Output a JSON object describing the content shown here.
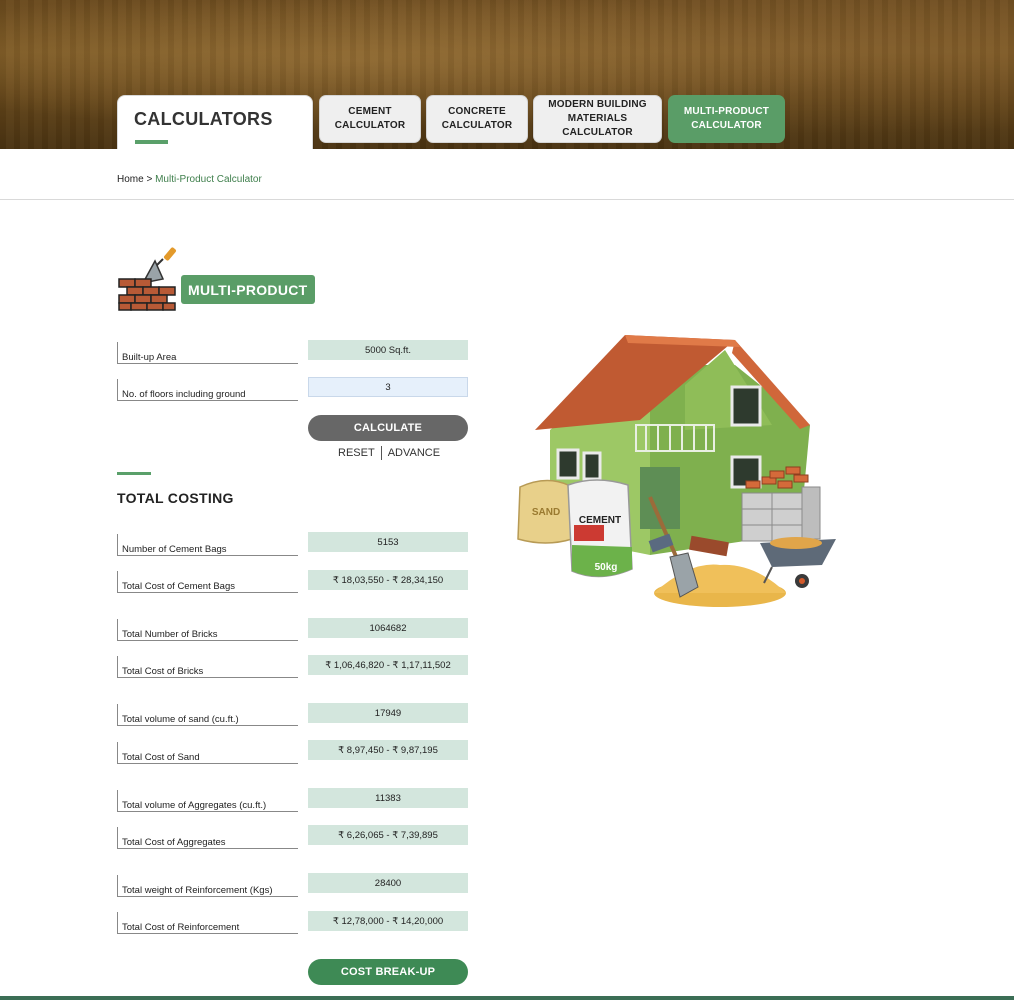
{
  "header": {
    "section_title": "CALCULATORS",
    "tabs": [
      {
        "label": "CEMENT\nCALCULATOR"
      },
      {
        "label": "CONCRETE\nCALCULATOR"
      },
      {
        "label": "MODERN BUILDING\nMATERIALS\nCALCULATOR"
      },
      {
        "label": "MULTI-PRODUCT\nCALCULATOR",
        "active": true
      }
    ]
  },
  "breadcrumb": {
    "home": "Home",
    "separator": ">",
    "current": "Multi-Product Calculator"
  },
  "product": {
    "badge_label": "MULTI-PRODUCT",
    "icon": "brick-trowel-icon"
  },
  "inputs": {
    "built_up_area": {
      "label": "Built-up Area",
      "value": "5000 Sq.ft."
    },
    "floors": {
      "label": "No. of floors including ground",
      "value": "3"
    }
  },
  "actions": {
    "calculate": "CALCULATE",
    "reset": "RESET",
    "advance": "ADVANCE",
    "cost_breakup": "COST BREAK-UP"
  },
  "totals": {
    "title": "TOTAL COSTING",
    "rows": [
      {
        "label": "Number of Cement Bags",
        "value": "5153"
      },
      {
        "label": "Total Cost of Cement Bags",
        "value": "₹ 18,03,550 - ₹ 28,34,150"
      },
      {
        "label": "Total Number of Bricks",
        "value": "1064682"
      },
      {
        "label": "Total Cost of Bricks",
        "value": "₹ 1,06,46,820 - ₹ 1,17,11,502"
      },
      {
        "label": "Total volume of sand (cu.ft.)",
        "value": "17949"
      },
      {
        "label": "Total Cost of Sand",
        "value": "₹ 8,97,450 - ₹ 9,87,195"
      },
      {
        "label": "Total volume of Aggregates (cu.ft.)",
        "value": "11383"
      },
      {
        "label": "Total Cost of Aggregates",
        "value": "₹ 6,26,065 - ₹ 7,39,895"
      },
      {
        "label": "Total weight of Reinforcement (Kgs)",
        "value": "28400"
      },
      {
        "label": "Total Cost of Reinforcement",
        "value": "₹ 12,78,000 - ₹ 14,20,000"
      }
    ]
  },
  "illustration": {
    "sand_bag_text": "SAND",
    "cement_bag_text": "CEMENT",
    "cement_weight": "50kg",
    "colors": {
      "roof": "#b9532c",
      "walls": "#8dbb57",
      "accent": "#5a9d67"
    }
  }
}
